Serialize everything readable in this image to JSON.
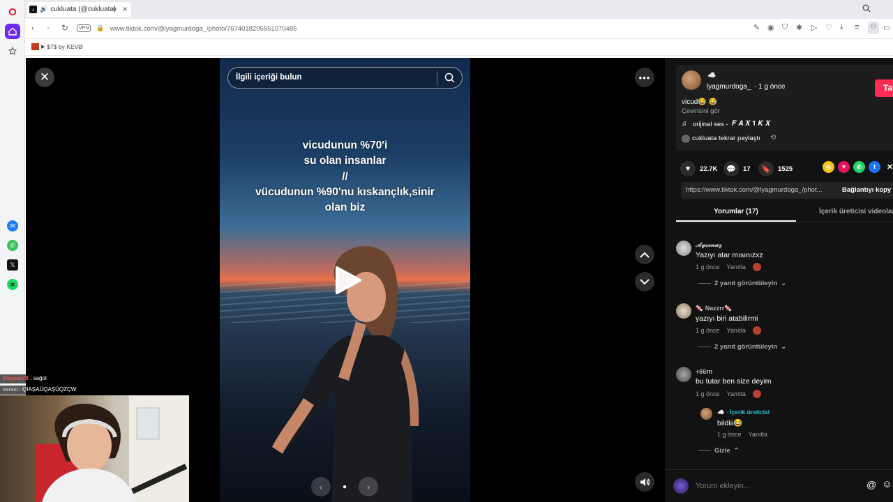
{
  "browser": {
    "tab_title": "cukluata (@cukluata)",
    "add_tab": "+",
    "vpn_label": "VPN",
    "url": "www.tiktok.com/@lyagmurdoga_/photo/7674018205551070485",
    "bookmark_label": "$7$ by KEVØ",
    "opera_logo": "O"
  },
  "viewer": {
    "search_placeholder": "İlgili içeriği bulun",
    "caption_lines": [
      "vicudunun %70'i",
      "su olan insanlar",
      "//",
      "vücudunun %90'nu kıskançlık,sinir",
      "olan biz"
    ],
    "close_symbol": "✕",
    "more_symbol": "•••"
  },
  "author": {
    "emoji": "☁️",
    "username": "lyagmurdoga_",
    "time": "· 1 g önce",
    "follow_label": "Takip",
    "desc": "vicud😂 😂",
    "see_translation": "Çevirisini gör",
    "sound_prefix": "orijinal ses - ",
    "sound_name": "𝑭 𝑨 𝑿 𝟏 𝑲 𝑿",
    "repost_text": "cukluata tekrar paylaştı"
  },
  "stats": {
    "likes": "22.7K",
    "comments": "17",
    "saves": "1525"
  },
  "link": {
    "url_text": "https://www.tiktok.com/@lyagmurdoga_/phot...",
    "copy_label": "Bağlantıyı kopy"
  },
  "tabs": {
    "comments": "Yorumlar (17)",
    "creator_videos": "İçerik üreticisi videoları"
  },
  "comments": [
    {
      "name": "𝓐𝔂𝓼𝓮𝓷𝓪𝔃",
      "text": "Yazıyı atar mısınızxz",
      "time": "1 g önce",
      "reply": "Yanıtla",
      "view_replies": "2 yanıt görüntüleyin"
    },
    {
      "name": "🍬 Nazzrr🍬",
      "text": "yazıyı biri atabilirmi",
      "time": "1 g önce",
      "reply": "Yanıtla",
      "view_replies": "2 yanıt görüntüleyin"
    },
    {
      "name": "+66rn",
      "text": "bu tutar ben size deyim",
      "time": "1 g önce",
      "reply": "Yanıtla"
    }
  ],
  "reply": {
    "name": "☁️ ·",
    "badge": "İçerik üreticisi",
    "text": "bildiii😂",
    "time": "1 g önce",
    "reply": "Yanıtla",
    "hide": "Gizle"
  },
  "comment_input": {
    "placeholder": "Yorum ekleyin...",
    "at_symbol": "@",
    "emoji_symbol": "☺"
  },
  "stream_chat": [
    {
      "user": "Beyaaa78",
      "msg": " : sağol"
    },
    {
      "user": "esrasi",
      "msg": " : QIAŞAÜQAŞÜQZÇW"
    }
  ]
}
